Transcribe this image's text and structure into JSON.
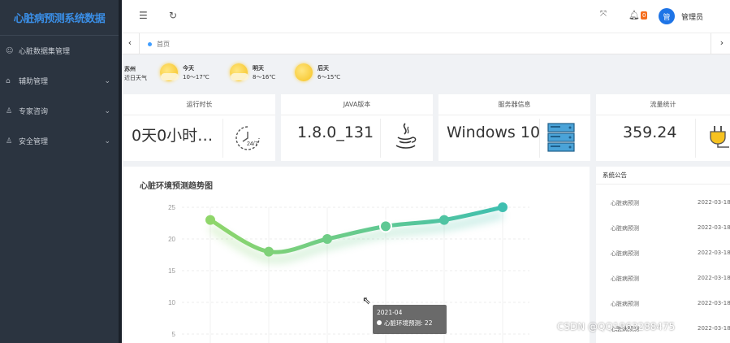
{
  "app": {
    "brand": "心脏病预测系统数据"
  },
  "sidebar": {
    "items": [
      {
        "label": "心脏数据集管理",
        "icon": "smile-icon",
        "has_chevron": false
      },
      {
        "label": "辅助管理",
        "icon": "home-icon",
        "has_chevron": true
      },
      {
        "label": "专家咨询",
        "icon": "user-icon",
        "has_chevron": true
      },
      {
        "label": "安全管理",
        "icon": "user-shield-icon",
        "has_chevron": true
      }
    ]
  },
  "topbar": {
    "badge_count": "0",
    "avatar_text": "管",
    "username": "管理员"
  },
  "tabs": {
    "home_label": "首页"
  },
  "weather": {
    "city": "苏州",
    "city_sub": "近日天气",
    "days": [
      {
        "label": "今天",
        "temp": "10～17℃",
        "icon": "partly-cloudy-icon"
      },
      {
        "label": "明天",
        "temp": "8～16℃",
        "icon": "partly-cloudy-icon"
      },
      {
        "label": "后天",
        "temp": "6～15℃",
        "icon": "sunny-icon"
      }
    ]
  },
  "stats": {
    "uptime": {
      "title": "运行时长",
      "value": "0天0小时…",
      "icon": "clock-24-7-icon"
    },
    "java": {
      "title": "JAVA版本",
      "value": "1.8.0_131",
      "icon": "java-icon"
    },
    "server": {
      "title": "服务器信息",
      "value": "Windows 10",
      "icon": "server-icon"
    },
    "traffic": {
      "title": "流量统计",
      "value": "359.24",
      "icon": "plug-icon"
    }
  },
  "chart_data": {
    "type": "line",
    "title": "心脏环境预测趋势图",
    "series": [
      {
        "name": "心脏环境预测",
        "values": [
          23,
          18,
          20,
          22,
          23,
          25
        ]
      }
    ],
    "yticks": [
      5,
      10,
      15,
      20,
      25
    ],
    "ylim": [
      0,
      25
    ],
    "grid": true,
    "tooltip": {
      "category": "2021-04",
      "series": "心脏环境预测",
      "value": "22"
    },
    "colors": {
      "start": "#8fd66a",
      "end": "#3fbfb0"
    }
  },
  "notice": {
    "title": "系统公告",
    "items": [
      {
        "label": "心脏病预测",
        "date": "2022-03-18"
      },
      {
        "label": "心脏病预测",
        "date": "2022-03-18"
      },
      {
        "label": "心脏病预测",
        "date": "2022-03-18"
      },
      {
        "label": "心脏病预测",
        "date": "2022-03-18"
      },
      {
        "label": "心脏病预测",
        "date": "2022-03-18"
      },
      {
        "label": "心脏病预测",
        "date": "2022-03-18"
      }
    ]
  },
  "watermark": "CSDN @QQ1963288475"
}
